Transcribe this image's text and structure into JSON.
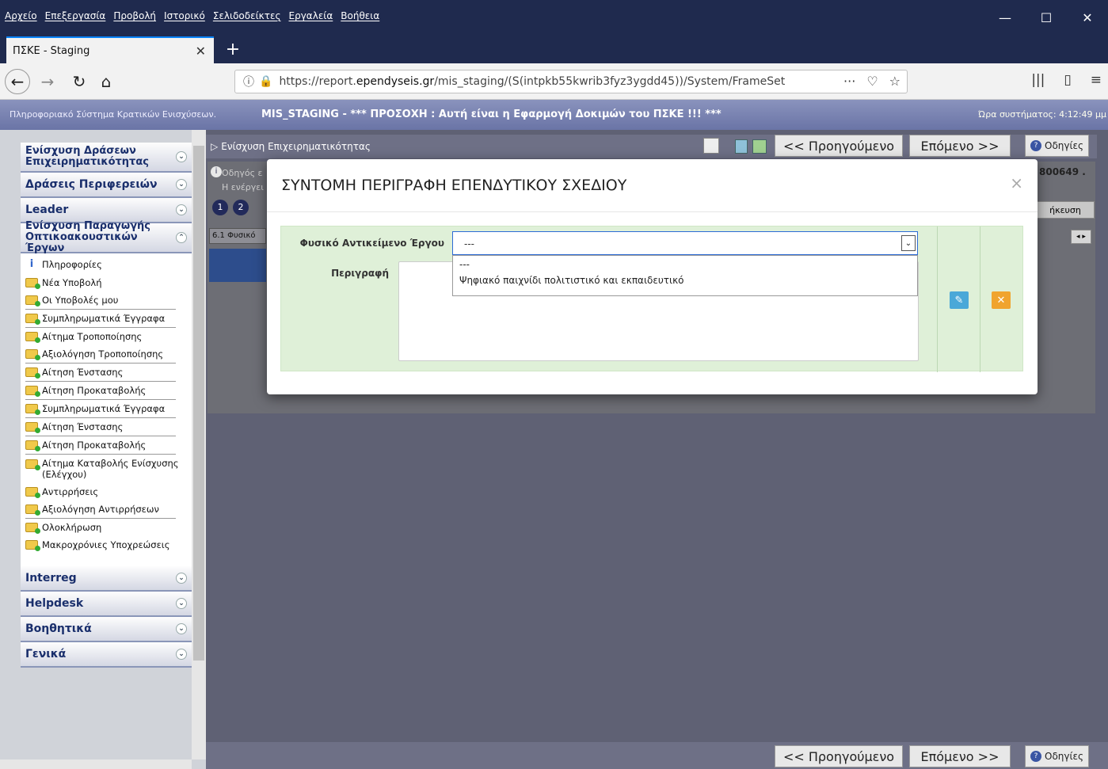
{
  "browser": {
    "menu": [
      "Αρχείο",
      "Επεξεργασία",
      "Προβολή",
      "Ιστορικό",
      "Σελιδοδείκτες",
      "Εργαλεία",
      "Βοήθεια"
    ],
    "tab_title": "ΠΣΚΕ - Staging",
    "url_prefix": "https://report.",
    "url_domain": "ependyseis.gr",
    "url_rest": "/mis_staging/(S(intpkb55kwrib3fyz3ygdd45))/System/FrameSet",
    "icons": [
      "back-icon",
      "forward-icon",
      "reload-icon",
      "home-icon",
      "lock-icon",
      "library-icon",
      "sidebar-icon",
      "menu-icon"
    ]
  },
  "app_header": {
    "left": "Πληροφοριακό Σύστημα Κρατικών Ενισχύσεων.",
    "middle": "MIS_STAGING - *** ΠΡΟΣΟΧΗ : Αυτή είναι η Εφαρμογή Δοκιμών του ΠΣΚΕ !!! ***",
    "right": "Ώρα συστήματος: 4:12:49 μμ"
  },
  "sidebar": {
    "sections_top": [
      {
        "label": "Ενίσχυση Δράσεων Επιχειρηματικότητας"
      },
      {
        "label": "Δράσεις Περιφερειών"
      },
      {
        "label": "Leader"
      },
      {
        "label": "Ενίσχυση Παραγωγής Οπτικοακουστικών Έργων"
      }
    ],
    "items": [
      "Πληροφορίες",
      "Νέα Υποβολή",
      "Οι Υποβολές μου",
      "Συμπληρωματικά Έγγραφα",
      "Αίτημα Τροποποίησης",
      "Αξιολόγηση Τροποποίησης",
      "Αίτηση Ένστασης",
      "Αίτηση Προκαταβολής",
      "Συμπληρωματικά Έγγραφα",
      "Αίτηση Ένστασης",
      "Αίτηση Προκαταβολής",
      "Αίτημα Καταβολής Ενίσχυσης (Ελέγχου)",
      "Αντιρρήσεις",
      "Αξιολόγηση Αντιρρήσεων",
      "Ολοκλήρωση",
      "Μακροχρόνιες Υποχρεώσεις"
    ],
    "sections_bottom": [
      "Interreg",
      "Helpdesk",
      "Βοηθητικά",
      "Γενικά"
    ]
  },
  "main": {
    "breadcrumb": "Ενίσχυση Επιχειρηματικότητας",
    "prev_label": "<< Προηγούμενο",
    "next_label": "Επόμενο >>",
    "help_label": "Οδηγίες",
    "bg_fragments": {
      "guide": "Οδηγός ε",
      "active": "Η ενέργει",
      "code": "800649 .",
      "save_partial": "ήκευση",
      "tab_partial": "6.1 Φυσικό"
    }
  },
  "modal": {
    "title": "ΣΥΝΤΟΜΗ ΠΕΡΙΓΡΑΦΗ ΕΠΕΝΔΥΤΙΚΟΥ ΣΧΕΔΙΟΥ",
    "close": "×",
    "field1_label": "Φυσικό Αντικείμενο Έργου",
    "field1_value": "---",
    "field1_options": [
      "---",
      "Ψηφιακό παιχνίδι πολιτιστικό και εκπαιδευτικό"
    ],
    "field2_label": "Περιγραφή",
    "field2_value": ""
  }
}
